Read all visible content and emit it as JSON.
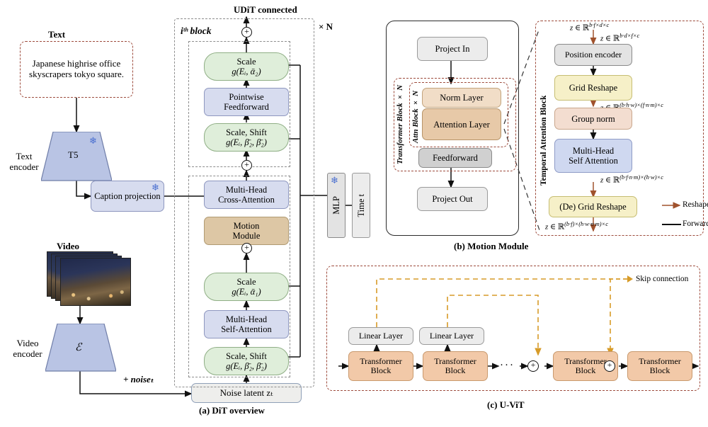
{
  "figure": {
    "panels": {
      "a_caption": "(a) DiT overview",
      "b_caption": "(b) Motion Module",
      "c_caption": "(c) U-ViT"
    }
  },
  "panel_a": {
    "text_label": "Text",
    "prompt": "Japanese highrise office skyscrapers tokyo square.",
    "text_encoder_label": "Text encoder",
    "t5_label": "T5",
    "caption_projection_label": "Caption projection",
    "video_label": "Video",
    "video_encoder_label": "Video encoder",
    "vae_label": "ℰ",
    "noise_label": "+ noiseₜ",
    "noise_latent_label": "Noise latent zₜ",
    "udit_label": "UDiT connected",
    "times_n": "× N",
    "ith_block": "iᵗʰ block",
    "mlp_label": "MLP",
    "time_label": "Time t",
    "blocks": {
      "scale_alpha2_line1": "Scale",
      "scale_alpha2_line2": "g(Eᵢ, ᾱ₂)",
      "pointwise_line1": "Pointwise",
      "pointwise_line2": "Feedforward",
      "scaleshift_beta2_line1": "Scale, Shift",
      "scaleshift_beta2_line2": "g(Eᵢ, β̄₂, β̄₂)",
      "cross_attn_line1": "Multi-Head",
      "cross_attn_line2": "Cross-Attention",
      "motion_line1": "Motion",
      "motion_line2": "Module",
      "scale_alpha1_line1": "Scale",
      "scale_alpha1_line2": "g(Eᵢ, ᾱ₁)",
      "self_attn_line1": "Multi-Head",
      "self_attn_line2": "Self-Attention",
      "scaleshift_beta1_line1": "Scale, Shift",
      "scaleshift_beta1_line2": "g(Eᵢ, β̄₂, β̄₂)"
    }
  },
  "panel_b": {
    "project_in": "Project In",
    "project_out": "Project  Out",
    "norm_layer": "Norm Layer",
    "attention_layer": "Attention Layer",
    "feedforward": "Feedforward",
    "transformer_block_n": "Transformer Block × N",
    "attn_block_n": "Attn Block × N",
    "temporal_attention_block": "Temporal Attention Block",
    "position_encoder": "Position encoder",
    "grid_reshape": "Grid Reshape",
    "group_norm": "Group norm",
    "mhsa_line1": "Multi-Head",
    "mhsa_line2": "Self Attention",
    "de_grid_reshape": "(De) Grid Reshape",
    "shapes": {
      "in_top": "z ∈ ℝ^{b·f×d×c}",
      "in_second": "z ∈ ℝ^{b·d×f×c}",
      "after_grid": "z ∈ ℝ^{(b·h·w)×(f·n·m)×c}",
      "after_mhsa": "z ∈ ℝ^{(b·f·n·m)×(h·w)×c}",
      "out_bottom": "z ∈ ℝ^{(b·f)×(h·w·n·m)×c}"
    },
    "legend": {
      "reshape": "Reshape",
      "forward": "Forward",
      "reshape_color": "#a0522d",
      "forward_color": "#1a1a1a"
    }
  },
  "panel_c": {
    "skip_connection": "Skip connection",
    "skip_color": "#d79b28",
    "linear_layer": "Linear Layer",
    "transformer_block": "Transformer Block",
    "ellipsis": "···",
    "blocks": [
      {
        "label_line1": "Transformer",
        "label_line2": "Block"
      },
      {
        "label_line1": "Transformer",
        "label_line2": "Block"
      },
      {
        "label_line1": "Transformer",
        "label_line2": "Block"
      },
      {
        "label_line1": "Transformer",
        "label_line2": "Block"
      }
    ],
    "linear_layers": [
      "Linear Layer",
      "Linear Layer"
    ]
  },
  "colors": {
    "green": "#dfeeda",
    "blue": "#d7dcef",
    "tan": "#ddc7a5",
    "peach": "#f2c9a8",
    "yellow": "#f6f0c8",
    "dashed_red": "#9d4b3c",
    "snowflake": "#4a6fd0"
  },
  "icons": {
    "snowflake": "❄",
    "plus_circle": "⊕"
  }
}
